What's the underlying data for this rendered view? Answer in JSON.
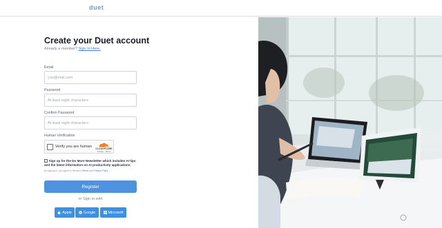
{
  "header": {
    "brand": "duet"
  },
  "form": {
    "title": "Create your Duet account",
    "already_member": "Already a member?",
    "sign_in_link": "Sign In Here.",
    "email": {
      "label": "Email",
      "placeholder": "you@mail.com",
      "value": ""
    },
    "password": {
      "label": "Password",
      "placeholder": "At least eight characters",
      "value": ""
    },
    "confirm_password": {
      "label": "Confirm Password",
      "placeholder": "At least eight characters",
      "value": ""
    },
    "verification": {
      "label": "Human Verification",
      "checkbox_text": "Verify you are human",
      "provider": "CLOUDFLARE",
      "provider_links": "Privacy · Terms"
    },
    "newsletter": {
      "checked": false,
      "text": "Sign up for the Do More Newsletter which includes AI tips and the latest information on AI productivity applications."
    },
    "terms": {
      "prefix": "By signing in, you agree to Biortex's",
      "terms_link": "Terms",
      "and": "and",
      "privacy_link": "Privacy Policy"
    },
    "register_label": "Register",
    "or_sign_in": "or Sign in with",
    "sso": {
      "apple": "Apple",
      "google": "Google",
      "microsoft": "Microsoft"
    }
  },
  "colors": {
    "brand": "#6f97cc",
    "primary_button": "#4f92e0",
    "sso_button": "#3d8fe0",
    "link": "#3f7bd1"
  },
  "icons": {
    "apple": "apple-icon",
    "google": "google-icon",
    "microsoft": "microsoft-icon",
    "cloudflare": "cloudflare-logo-icon"
  }
}
